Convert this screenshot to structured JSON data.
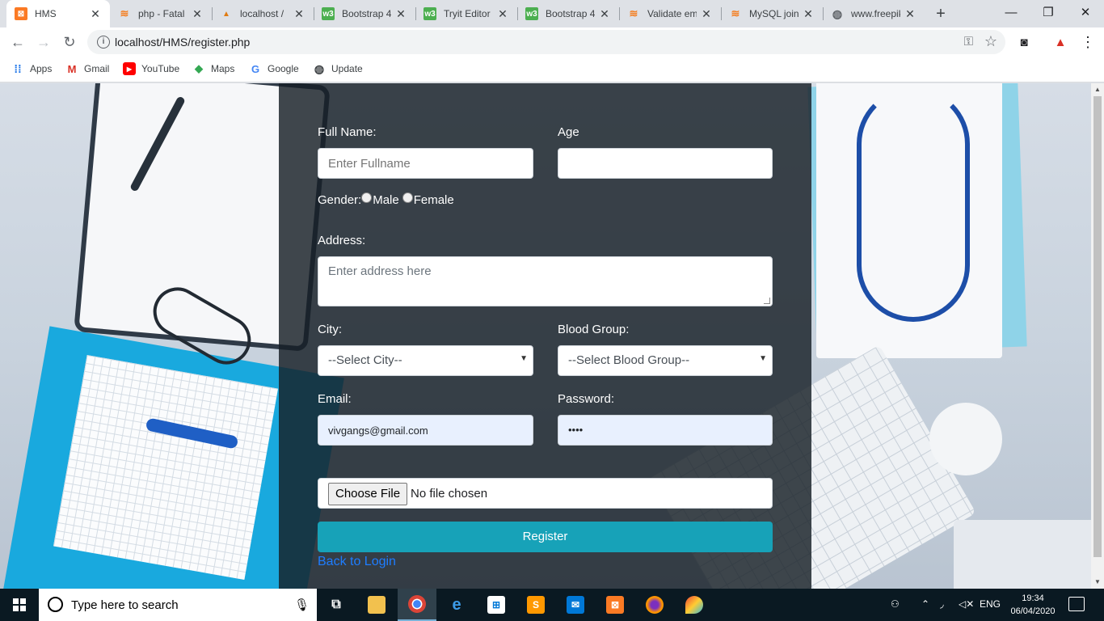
{
  "browser": {
    "tabs": [
      {
        "title": "HMS",
        "icon": "xampp-icon",
        "active": true
      },
      {
        "title": "php - Fatal",
        "icon": "stackoverflow-icon"
      },
      {
        "title": "localhost /",
        "icon": "phpmyadmin-icon"
      },
      {
        "title": "Bootstrap 4",
        "icon": "w3schools-icon"
      },
      {
        "title": "Tryit Editor",
        "icon": "w3schools-icon"
      },
      {
        "title": "Bootstrap 4",
        "icon": "w3schools-icon"
      },
      {
        "title": "Validate em",
        "icon": "stackoverflow-icon"
      },
      {
        "title": "MySQL join",
        "icon": "stackoverflow-icon"
      },
      {
        "title": "www.freepik",
        "icon": "globe-icon"
      }
    ],
    "url": "localhost/HMS/register.php",
    "bookmarks": [
      {
        "label": "Apps",
        "icon": "apps-grid-icon"
      },
      {
        "label": "Gmail",
        "icon": "gmail-icon"
      },
      {
        "label": "YouTube",
        "icon": "youtube-icon"
      },
      {
        "label": "Maps",
        "icon": "maps-icon"
      },
      {
        "label": "Google",
        "icon": "google-icon"
      },
      {
        "label": "Update",
        "icon": "globe-icon"
      }
    ]
  },
  "form": {
    "fullname_label": "Full Name:",
    "fullname_placeholder": "Enter Fullname",
    "age_label": "Age",
    "age_value": "",
    "gender_label": "Gender:",
    "gender_male": "Male",
    "gender_female": "Female",
    "address_label": "Address:",
    "address_placeholder": "Enter address here",
    "city_label": "City:",
    "city_selected": "--Select City--",
    "blood_label": "Blood Group:",
    "blood_selected": "--Select Blood Group--",
    "email_label": "Email:",
    "email_value": "vivgangs@gmail.com",
    "password_label": "Password:",
    "password_value": "••••",
    "file_button": "Choose File",
    "file_status": "No file chosen",
    "register_button": "Register",
    "back_link": "Back to Login"
  },
  "taskbar": {
    "search_placeholder": "Type here to search",
    "language": "ENG",
    "time": "19:34",
    "date": "06/04/2020",
    "apps": [
      "task-view-icon",
      "file-explorer-icon",
      "chrome-icon",
      "edge-icon",
      "store-icon",
      "sublime-text-icon",
      "mail-icon",
      "xampp-icon",
      "firefox-icon",
      "paint3d-icon"
    ]
  },
  "colors": {
    "register_button": "#17a2b8",
    "link": "#1e7dff",
    "panel": "#161e26"
  }
}
